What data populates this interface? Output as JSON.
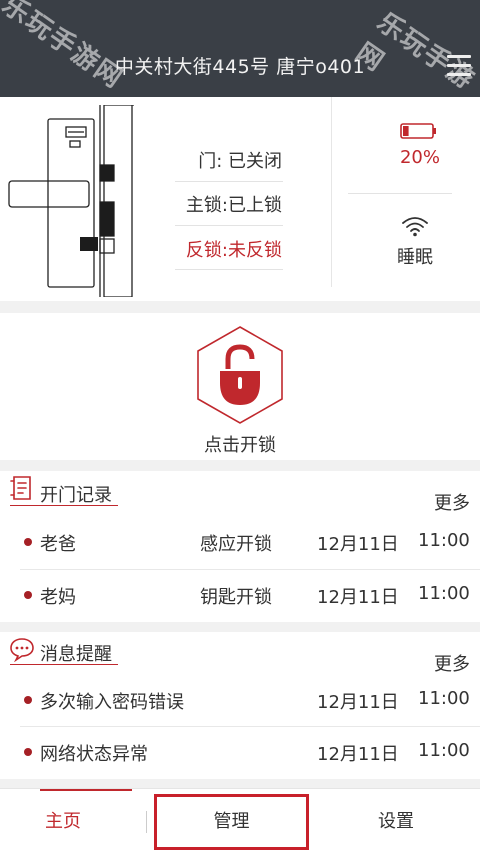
{
  "header": {
    "title": "中关村大街445号 唐宁o401",
    "menu_icon": "hamburger-menu-icon"
  },
  "watermark": {
    "text": "乐玩手游网"
  },
  "status": {
    "door": {
      "label": "门",
      "value": "已关闭"
    },
    "main_lock": {
      "label": "主锁",
      "value": "已上锁"
    },
    "deadbolt": {
      "label": "反锁",
      "value": "未反锁"
    },
    "door_text": "门: 已关闭",
    "main_lock_text": "主锁:已上锁",
    "deadbolt_text": "反锁:未反锁",
    "battery_icon": "battery-icon",
    "battery_level": 0.2,
    "battery_text": "20%",
    "wifi_icon": "wifi-icon",
    "sleep_text": "睡眠"
  },
  "unlock": {
    "icon": "padlock-unlock-icon",
    "label": "点击开锁"
  },
  "door_records": {
    "icon": "record-list-icon",
    "title": "开门记录",
    "more": "更多",
    "items": [
      {
        "name": "老爸",
        "method": "感应开锁",
        "date": "12月11日",
        "time": "11:00"
      },
      {
        "name": "老妈",
        "method": "钥匙开锁",
        "date": "12月11日",
        "time": "11:00"
      }
    ]
  },
  "messages": {
    "icon": "chat-bubble-icon",
    "title": "消息提醒",
    "more": "更多",
    "items": [
      {
        "text": "多次输入密码错误",
        "date": "12月11日",
        "time": "11:00"
      },
      {
        "text": "网络状态异常",
        "date": "12月11日",
        "time": "11:00"
      }
    ]
  },
  "bottom_nav": {
    "home": "主页",
    "manage": "管理",
    "settings": "设置"
  },
  "colors": {
    "accent": "#c0282d",
    "header_bg": "#3a3f46",
    "page_bg": "#f1f1f1"
  }
}
